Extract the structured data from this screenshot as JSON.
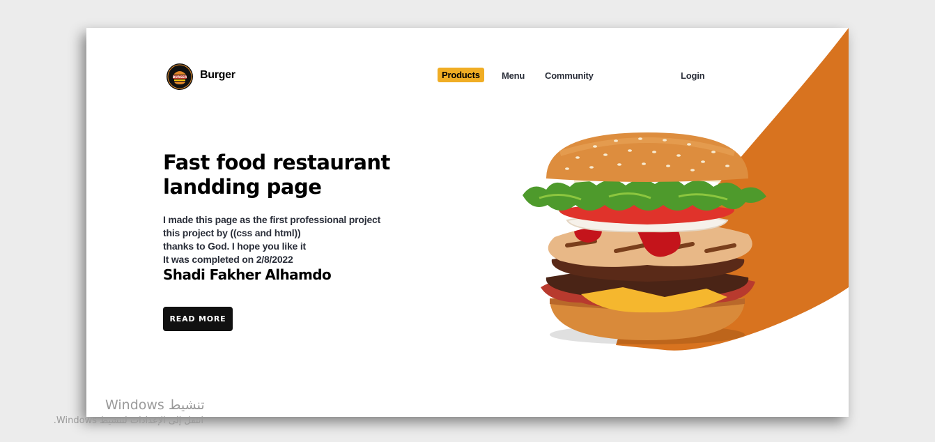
{
  "header": {
    "brand": "Burger",
    "logo_text": "BURGER",
    "nav": {
      "products": "Products",
      "menu": "Menu",
      "community": "Community",
      "login": "Login"
    }
  },
  "hero": {
    "title_line1": "Fast food restaurant",
    "title_line2": "landding page",
    "lines": [
      "I made this page as the first professional project",
      "this project by ((css and html))",
      "thanks to God. I hope you like it",
      "It was completed on 2/8/2022"
    ],
    "author": "Shadi Fakher Alhamdo",
    "button": "READ MORE"
  },
  "watermark": {
    "title": "تنشيط Windows",
    "subtitle": "انتقل إلى الإعدادات لتنشيط Windows."
  },
  "colors": {
    "accent": "#d8731f",
    "products_highlight": "#f0ad24",
    "button_bg": "#111111"
  },
  "icons": {
    "logo": "burger-logo-icon",
    "hero_image": "burger-image"
  }
}
